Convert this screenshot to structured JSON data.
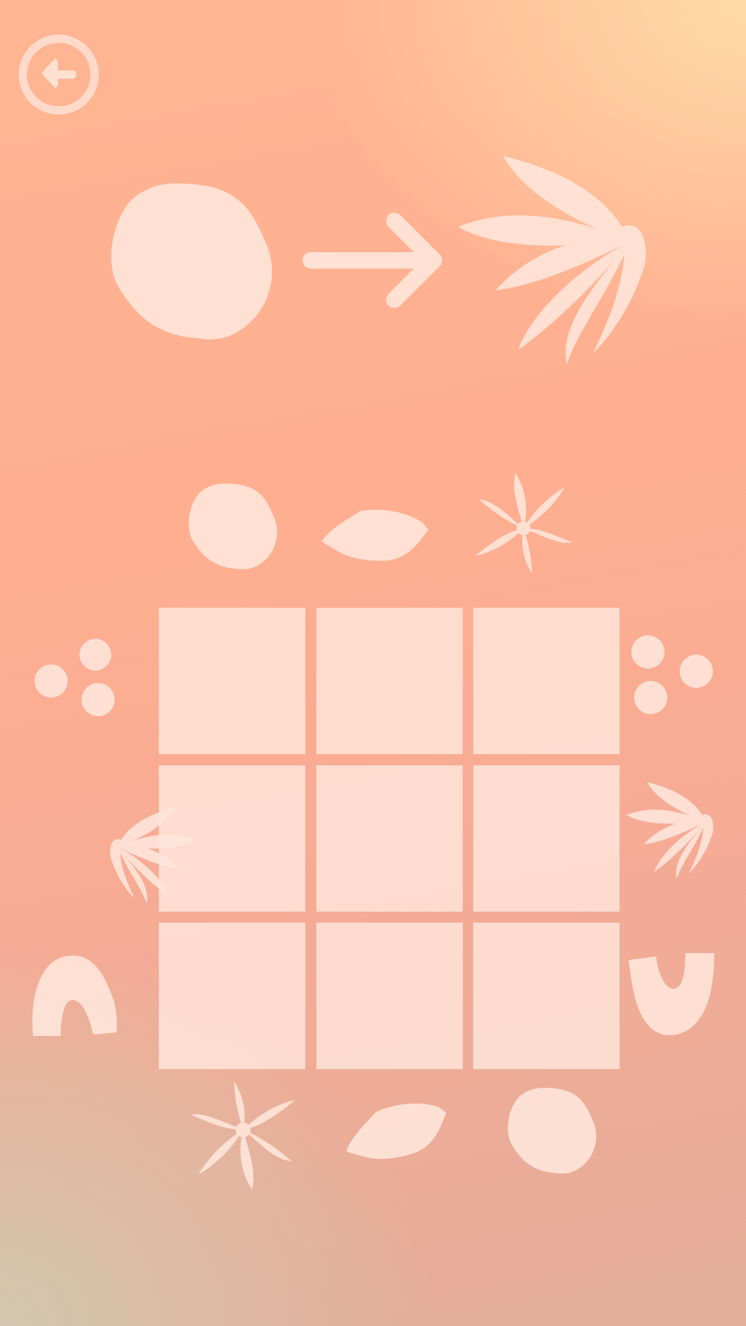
{
  "screen": "pattern-puzzle",
  "colors": {
    "shape_fill": "#ffe7dc",
    "gradient_top": "#ffd6a8",
    "gradient_middle": "#ffae90",
    "gradient_bottom": "#d4c6b0"
  },
  "header": {
    "back_icon": "back-arrow-circle-icon"
  },
  "rule": {
    "from_icon": "round-blob-icon",
    "arrow_icon": "right-arrow-icon",
    "to_icon": "leaf-icon"
  },
  "clues": {
    "top": [
      "round-blob-icon",
      "lens-blob-icon",
      "star-flower-icon"
    ],
    "bottom": [
      "star-flower-icon",
      "lens-blob-icon",
      "round-blob-icon"
    ],
    "left": [
      "three-dots-icon",
      "leaf-icon",
      "arch-icon"
    ],
    "right": [
      "three-dots-icon",
      "leaf-icon",
      "cup-icon"
    ]
  },
  "grid": {
    "rows": 3,
    "cols": 3,
    "cells": [
      [
        "",
        "",
        ""
      ],
      [
        "",
        "",
        ""
      ],
      [
        "",
        "",
        ""
      ]
    ]
  }
}
